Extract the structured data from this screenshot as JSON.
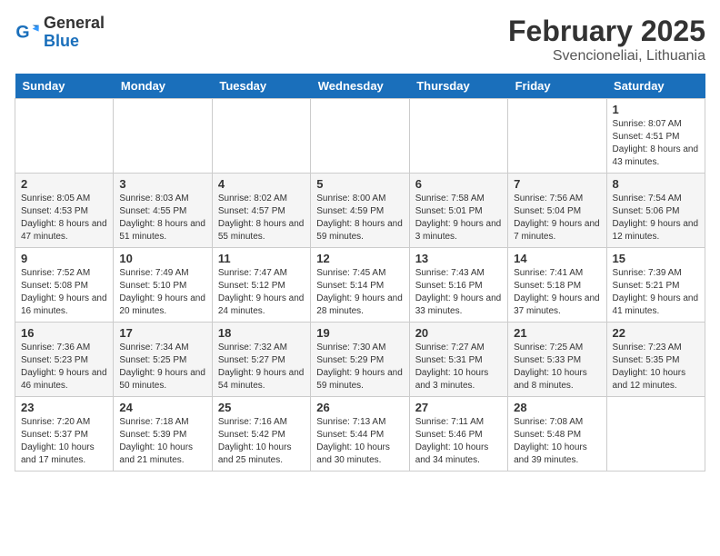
{
  "header": {
    "logo": {
      "general": "General",
      "blue": "Blue"
    },
    "title": "February 2025",
    "subtitle": "Svencioneliai, Lithuania"
  },
  "calendar": {
    "days_of_week": [
      "Sunday",
      "Monday",
      "Tuesday",
      "Wednesday",
      "Thursday",
      "Friday",
      "Saturday"
    ],
    "weeks": [
      [
        {
          "day": "",
          "info": ""
        },
        {
          "day": "",
          "info": ""
        },
        {
          "day": "",
          "info": ""
        },
        {
          "day": "",
          "info": ""
        },
        {
          "day": "",
          "info": ""
        },
        {
          "day": "",
          "info": ""
        },
        {
          "day": "1",
          "info": "Sunrise: 8:07 AM\nSunset: 4:51 PM\nDaylight: 8 hours and 43 minutes."
        }
      ],
      [
        {
          "day": "2",
          "info": "Sunrise: 8:05 AM\nSunset: 4:53 PM\nDaylight: 8 hours and 47 minutes."
        },
        {
          "day": "3",
          "info": "Sunrise: 8:03 AM\nSunset: 4:55 PM\nDaylight: 8 hours and 51 minutes."
        },
        {
          "day": "4",
          "info": "Sunrise: 8:02 AM\nSunset: 4:57 PM\nDaylight: 8 hours and 55 minutes."
        },
        {
          "day": "5",
          "info": "Sunrise: 8:00 AM\nSunset: 4:59 PM\nDaylight: 8 hours and 59 minutes."
        },
        {
          "day": "6",
          "info": "Sunrise: 7:58 AM\nSunset: 5:01 PM\nDaylight: 9 hours and 3 minutes."
        },
        {
          "day": "7",
          "info": "Sunrise: 7:56 AM\nSunset: 5:04 PM\nDaylight: 9 hours and 7 minutes."
        },
        {
          "day": "8",
          "info": "Sunrise: 7:54 AM\nSunset: 5:06 PM\nDaylight: 9 hours and 12 minutes."
        }
      ],
      [
        {
          "day": "9",
          "info": "Sunrise: 7:52 AM\nSunset: 5:08 PM\nDaylight: 9 hours and 16 minutes."
        },
        {
          "day": "10",
          "info": "Sunrise: 7:49 AM\nSunset: 5:10 PM\nDaylight: 9 hours and 20 minutes."
        },
        {
          "day": "11",
          "info": "Sunrise: 7:47 AM\nSunset: 5:12 PM\nDaylight: 9 hours and 24 minutes."
        },
        {
          "day": "12",
          "info": "Sunrise: 7:45 AM\nSunset: 5:14 PM\nDaylight: 9 hours and 28 minutes."
        },
        {
          "day": "13",
          "info": "Sunrise: 7:43 AM\nSunset: 5:16 PM\nDaylight: 9 hours and 33 minutes."
        },
        {
          "day": "14",
          "info": "Sunrise: 7:41 AM\nSunset: 5:18 PM\nDaylight: 9 hours and 37 minutes."
        },
        {
          "day": "15",
          "info": "Sunrise: 7:39 AM\nSunset: 5:21 PM\nDaylight: 9 hours and 41 minutes."
        }
      ],
      [
        {
          "day": "16",
          "info": "Sunrise: 7:36 AM\nSunset: 5:23 PM\nDaylight: 9 hours and 46 minutes."
        },
        {
          "day": "17",
          "info": "Sunrise: 7:34 AM\nSunset: 5:25 PM\nDaylight: 9 hours and 50 minutes."
        },
        {
          "day": "18",
          "info": "Sunrise: 7:32 AM\nSunset: 5:27 PM\nDaylight: 9 hours and 54 minutes."
        },
        {
          "day": "19",
          "info": "Sunrise: 7:30 AM\nSunset: 5:29 PM\nDaylight: 9 hours and 59 minutes."
        },
        {
          "day": "20",
          "info": "Sunrise: 7:27 AM\nSunset: 5:31 PM\nDaylight: 10 hours and 3 minutes."
        },
        {
          "day": "21",
          "info": "Sunrise: 7:25 AM\nSunset: 5:33 PM\nDaylight: 10 hours and 8 minutes."
        },
        {
          "day": "22",
          "info": "Sunrise: 7:23 AM\nSunset: 5:35 PM\nDaylight: 10 hours and 12 minutes."
        }
      ],
      [
        {
          "day": "23",
          "info": "Sunrise: 7:20 AM\nSunset: 5:37 PM\nDaylight: 10 hours and 17 minutes."
        },
        {
          "day": "24",
          "info": "Sunrise: 7:18 AM\nSunset: 5:39 PM\nDaylight: 10 hours and 21 minutes."
        },
        {
          "day": "25",
          "info": "Sunrise: 7:16 AM\nSunset: 5:42 PM\nDaylight: 10 hours and 25 minutes."
        },
        {
          "day": "26",
          "info": "Sunrise: 7:13 AM\nSunset: 5:44 PM\nDaylight: 10 hours and 30 minutes."
        },
        {
          "day": "27",
          "info": "Sunrise: 7:11 AM\nSunset: 5:46 PM\nDaylight: 10 hours and 34 minutes."
        },
        {
          "day": "28",
          "info": "Sunrise: 7:08 AM\nSunset: 5:48 PM\nDaylight: 10 hours and 39 minutes."
        },
        {
          "day": "",
          "info": ""
        }
      ]
    ]
  }
}
